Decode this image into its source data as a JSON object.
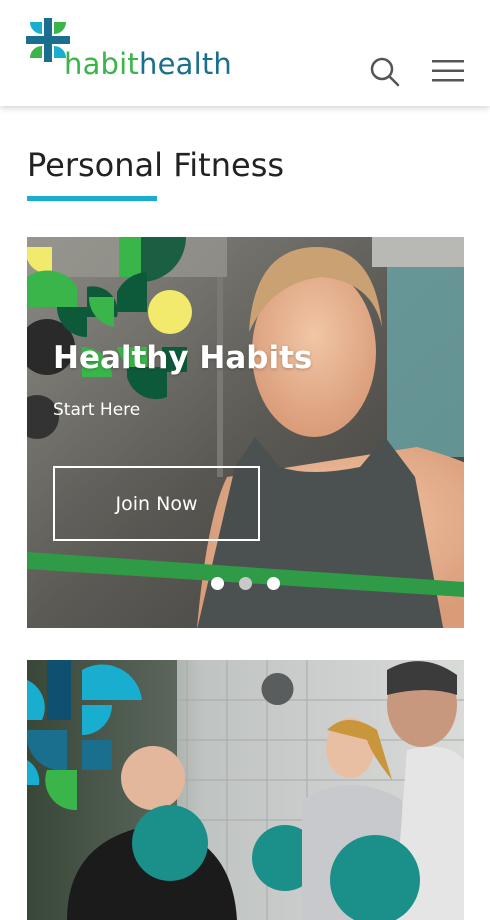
{
  "header": {
    "logo": {
      "part1": "habit",
      "part2": "health"
    },
    "search_icon": "search-icon",
    "menu_icon": "hamburger-menu-icon"
  },
  "page": {
    "title": "Personal Fitness"
  },
  "hero": {
    "title": "Healthy Habits",
    "subtitle": "Start Here",
    "cta": "Join Now",
    "slides": 3,
    "active_slide": 1
  },
  "colors": {
    "brand_green": "#3ab54a",
    "brand_teal": "#1a6f8f",
    "accent_cyan": "#19aed0",
    "accent_yellow": "#f2ea6c"
  }
}
